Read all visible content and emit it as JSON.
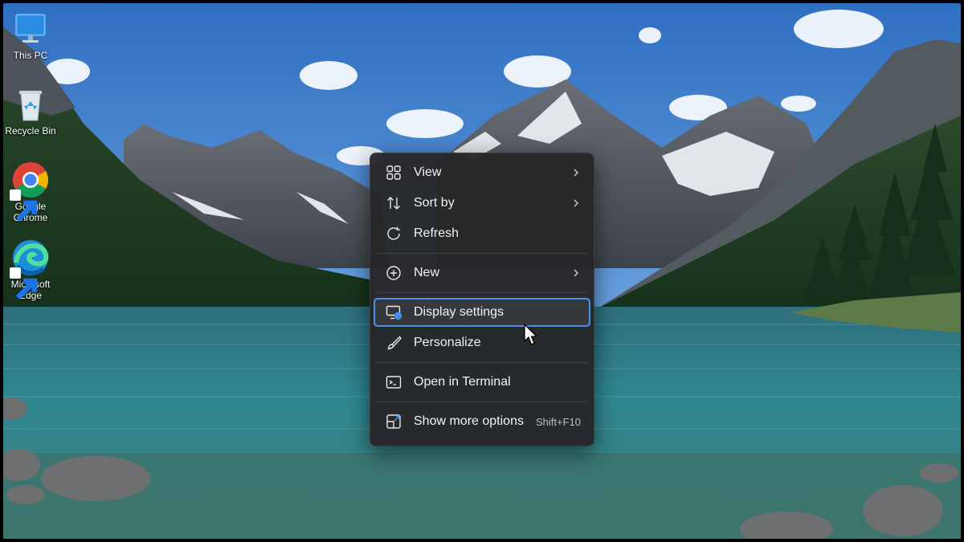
{
  "desktop": {
    "icons": [
      {
        "label": "This PC",
        "icon": "monitor-icon"
      },
      {
        "label": "Recycle Bin",
        "icon": "recycle-bin-icon"
      },
      {
        "label": "Google Chrome",
        "icon": "chrome-icon",
        "shortcut": true
      },
      {
        "label": "Microsoft Edge",
        "icon": "edge-icon",
        "shortcut": true
      }
    ]
  },
  "context_menu": {
    "items": [
      {
        "label": "View",
        "icon": "grid-view-icon",
        "submenu": true
      },
      {
        "label": "Sort by",
        "icon": "sort-icon",
        "submenu": true
      },
      {
        "label": "Refresh",
        "icon": "refresh-icon"
      },
      {
        "label": "New",
        "icon": "plus-circle-icon",
        "submenu": true
      },
      {
        "label": "Display settings",
        "icon": "display-settings-icon",
        "highlighted": true
      },
      {
        "label": "Personalize",
        "icon": "brush-icon"
      },
      {
        "label": "Open in Terminal",
        "icon": "terminal-icon"
      },
      {
        "label": "Show more options",
        "icon": "more-options-icon",
        "shortcut": "Shift+F10"
      }
    ]
  },
  "colors": {
    "menu_bg": "#272729",
    "highlight_border": "#4a8fe7",
    "text": "#f2f2f2"
  }
}
